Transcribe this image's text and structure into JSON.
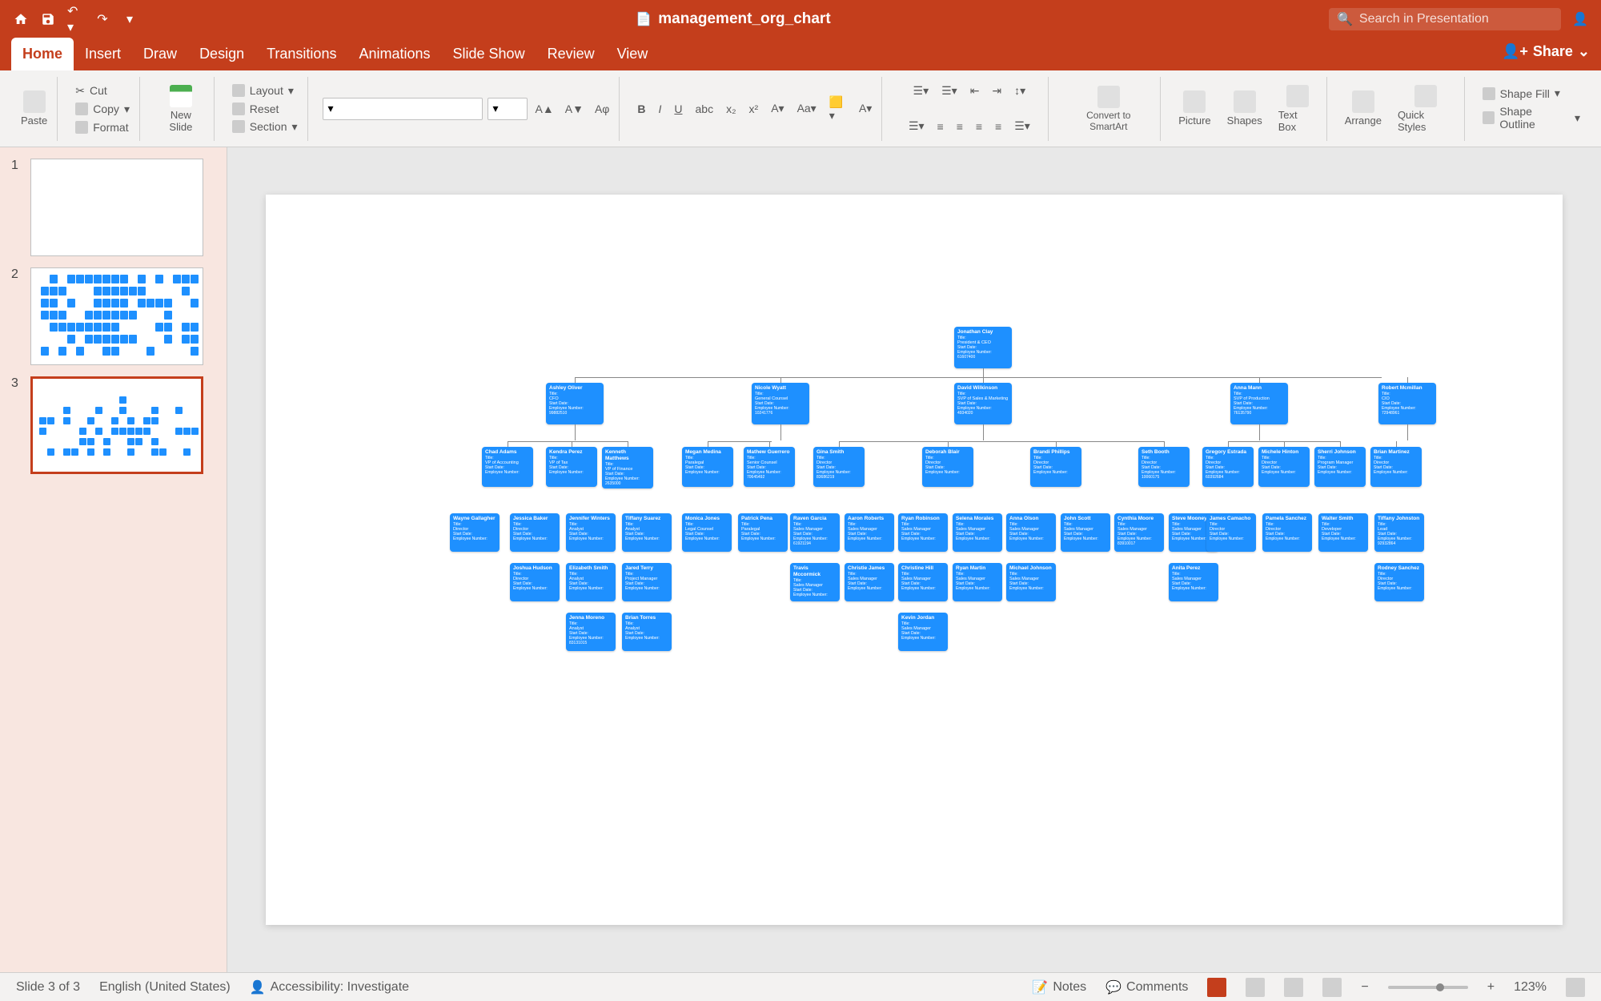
{
  "titlebar": {
    "title": "management_org_chart",
    "search_placeholder": "Search in Presentation"
  },
  "tabs": [
    "Home",
    "Insert",
    "Draw",
    "Design",
    "Transitions",
    "Animations",
    "Slide Show",
    "Review",
    "View"
  ],
  "active_tab": "Home",
  "share": "Share",
  "ribbon": {
    "paste": "Paste",
    "cut": "Cut",
    "copy": "Copy",
    "format": "Format",
    "new_slide": "New Slide",
    "layout": "Layout",
    "reset": "Reset",
    "section": "Section",
    "convert": "Convert to SmartArt",
    "picture": "Picture",
    "shapes": "Shapes",
    "textbox": "Text Box",
    "arrange": "Arrange",
    "quickstyles": "Quick Styles",
    "shapefill": "Shape Fill",
    "shapeoutline": "Shape Outline"
  },
  "thumbs": [
    1,
    2,
    3
  ],
  "selected_thumb": 3,
  "status": {
    "slide": "Slide 3 of 3",
    "lang": "English (United States)",
    "access": "Accessibility: Investigate",
    "notes": "Notes",
    "comments": "Comments",
    "zoom": "123%"
  },
  "org": {
    "ceo": {
      "name": "Jonathan Clay",
      "title": "President & CEO",
      "start": "Start Date",
      "emp": "Employee Number",
      "empno": "61607400"
    },
    "level2": [
      {
        "name": "Ashley Oliver",
        "title": "CFO",
        "start": "Start Date",
        "date": "",
        "emp": "Employee Number",
        "empno": "99882510"
      },
      {
        "name": "Nicole Wyatt",
        "title": "General Counsel",
        "start": "Start Date",
        "date": "",
        "emp": "Employee Number",
        "empno": "10241776"
      },
      {
        "name": "David Wilkinson",
        "title": "SVP of Sales & Marketing",
        "start": "Start Date",
        "date": "",
        "emp": "Employee Number",
        "empno": "4934020"
      },
      {
        "name": "Anna Mann",
        "title": "SVP of Production",
        "start": "Start Date",
        "date": "",
        "emp": "Employee Number",
        "empno": "76135790"
      },
      {
        "name": "Robert Mcmillan",
        "title": "CIO",
        "start": "Start Date",
        "date": "",
        "emp": "Employee Number",
        "empno": "72948961"
      }
    ],
    "level3": [
      {
        "name": "Chad Adams",
        "title": "VP of Accounting",
        "emp": "Employee Number",
        "empno": ""
      },
      {
        "name": "Kendra Perez",
        "title": "VP of Tax",
        "emp": "Employee Number",
        "empno": ""
      },
      {
        "name": "Kenneth Matthews",
        "title": "VP of Finance",
        "emp": "Employee Number",
        "empno": "2635000"
      },
      {
        "name": "Megan Medina",
        "title": "Paralegal",
        "emp": "Employee Number",
        "empno": ""
      },
      {
        "name": "Mathew Guerrero",
        "title": "Senior Counsel",
        "emp": "Employee Number",
        "empno": "70645492"
      },
      {
        "name": "Gina Smith",
        "title": "Director",
        "emp": "Employee Number",
        "empno": "83686219"
      },
      {
        "name": "Deborah Blair",
        "title": "Director",
        "emp": "Employee Number",
        "empno": ""
      },
      {
        "name": "Brandi Phillips",
        "title": "Director",
        "emp": "Employee Number",
        "empno": ""
      },
      {
        "name": "Seth Booth",
        "title": "Director",
        "emp": "Employee Number",
        "empno": "10060175"
      },
      {
        "name": "Gregory Estrada",
        "title": "Director",
        "emp": "Employee Number",
        "empno": "60392684"
      },
      {
        "name": "Michele Hinton",
        "title": "Director",
        "emp": "Employee Number",
        "empno": ""
      },
      {
        "name": "Sherri Johnson",
        "title": "Program Manager",
        "emp": "Employee Number",
        "empno": ""
      },
      {
        "name": "Brian Martinez",
        "title": "Director",
        "emp": "Employee Number",
        "empno": ""
      }
    ],
    "level4": [
      {
        "name": "Wayne Gallagher",
        "title": "Director",
        "emp": "",
        "empno": ""
      },
      {
        "name": "Jessica Baker",
        "title": "Director",
        "emp": "",
        "empno": ""
      },
      {
        "name": "Jennifer Winters",
        "title": "Analyst",
        "emp": "",
        "empno": ""
      },
      {
        "name": "Tiffany Suarez",
        "title": "Analyst",
        "emp": "",
        "empno": ""
      },
      {
        "name": "Monica Jones",
        "title": "Legal Counsel",
        "emp": "",
        "empno": ""
      },
      {
        "name": "Patrick Pena",
        "title": "Paralegal",
        "emp": "",
        "empno": ""
      },
      {
        "name": "Raven Garcia",
        "title": "Sales Manager",
        "emp": "",
        "empno": "61921194"
      },
      {
        "name": "Aaron Roberts",
        "title": "Sales Manager",
        "emp": "",
        "empno": ""
      },
      {
        "name": "Ryan Robinson",
        "title": "Sales Manager",
        "emp": "",
        "empno": ""
      },
      {
        "name": "Selena Morales",
        "title": "Sales Manager",
        "emp": "",
        "empno": ""
      },
      {
        "name": "Anna Olson",
        "title": "Sales Manager",
        "emp": "",
        "empno": ""
      },
      {
        "name": "John Scott",
        "title": "Sales Manager",
        "emp": "",
        "empno": ""
      },
      {
        "name": "Cynthia Moore",
        "title": "Sales Manager",
        "emp": "",
        "empno": "83910017"
      },
      {
        "name": "Steve Mooney",
        "title": "Sales Manager",
        "emp": "",
        "empno": ""
      },
      {
        "name": "James Camacho",
        "title": "Director",
        "emp": "",
        "empno": ""
      },
      {
        "name": "Pamela Sanchez",
        "title": "Director",
        "emp": "",
        "empno": ""
      },
      {
        "name": "Walter Smith",
        "title": "Developer",
        "emp": "",
        "empno": ""
      },
      {
        "name": "Tiffany Johnston",
        "title": "Lead",
        "emp": "",
        "empno": "92932864"
      }
    ],
    "level5": [
      {
        "name": "Joshua Hudson",
        "title": "Director",
        "emp": "",
        "empno": ""
      },
      {
        "name": "Elizabeth Smith",
        "title": "Analyst",
        "emp": "",
        "empno": ""
      },
      {
        "name": "Jared Terry",
        "title": "Project Manager",
        "emp": "",
        "empno": ""
      },
      {
        "name": "Travis Mccormick",
        "title": "Sales Manager",
        "emp": "",
        "empno": ""
      },
      {
        "name": "Christie James",
        "title": "Sales Manager",
        "emp": "",
        "empno": ""
      },
      {
        "name": "Christine Hill",
        "title": "Sales Manager",
        "emp": "",
        "empno": ""
      },
      {
        "name": "Ryan Martin",
        "title": "Sales Manager",
        "emp": "",
        "empno": ""
      },
      {
        "name": "Michael Johnson",
        "title": "Sales Manager",
        "emp": "",
        "empno": ""
      },
      {
        "name": "Anita Perez",
        "title": "Sales Manager",
        "emp": "",
        "empno": ""
      },
      {
        "name": "Rodney Sanchez",
        "title": "Director",
        "emp": "",
        "empno": ""
      }
    ],
    "level6": [
      {
        "name": "Jenna Moreno",
        "title": "Analyst",
        "emp": "",
        "empno": "83131015"
      },
      {
        "name": "Brian Torres",
        "title": "Analyst",
        "emp": "",
        "empno": ""
      },
      {
        "name": "Kevin Jordan",
        "title": "Sales Manager",
        "emp": "",
        "empno": ""
      }
    ]
  }
}
